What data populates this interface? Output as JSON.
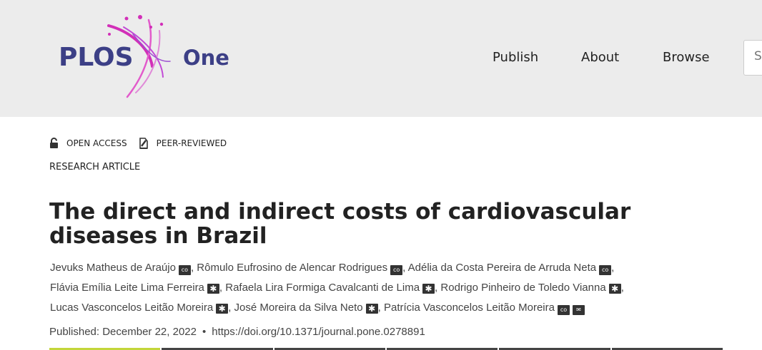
{
  "header": {
    "logo_plos": "PLOS",
    "logo_one": "One",
    "nav": [
      "Publish",
      "About",
      "Browse"
    ],
    "search_placeholder": "Search"
  },
  "badges": {
    "open_access": "OPEN ACCESS",
    "peer_reviewed": "PEER-REVIEWED"
  },
  "article": {
    "type": "RESEARCH ARTICLE",
    "title": "The direct and indirect costs of cardiovascular diseases in Brazil",
    "authors": [
      {
        "name": "Jevuks Matheus de Araújo",
        "icons": [
          "co"
        ]
      },
      {
        "name": "Rômulo Eufrosino de Alencar Rodrigues",
        "icons": [
          "co"
        ]
      },
      {
        "name": "Adélia da Costa Pereira de Arruda Neta",
        "icons": [
          "co"
        ]
      },
      {
        "name": "Flávia Emília Leite Lima Ferreira",
        "icons": [
          "star"
        ]
      },
      {
        "name": "Rafaela Lira Formiga Cavalcanti de Lima",
        "icons": [
          "star"
        ]
      },
      {
        "name": "Rodrigo Pinheiro de Toledo Vianna",
        "icons": [
          "star"
        ]
      },
      {
        "name": "Lucas Vasconcelos Leitão Moreira",
        "icons": [
          "star"
        ]
      },
      {
        "name": "José Moreira da Silva Neto",
        "icons": [
          "star"
        ]
      },
      {
        "name": "Patrícia Vasconcelos Leitão Moreira",
        "icons": [
          "co",
          "mail"
        ]
      }
    ],
    "published": "Published: December 22, 2022",
    "doi": "https://doi.org/10.1371/journal.pone.0278891"
  },
  "icon_labels": {
    "co": "co",
    "star": "✱",
    "mail": "✉"
  },
  "colors": {
    "header_bg": "#ececec",
    "logo_blue": "#3c3f86",
    "logo_pink": "#d22fb8",
    "active_tab": "#c3d63a"
  }
}
